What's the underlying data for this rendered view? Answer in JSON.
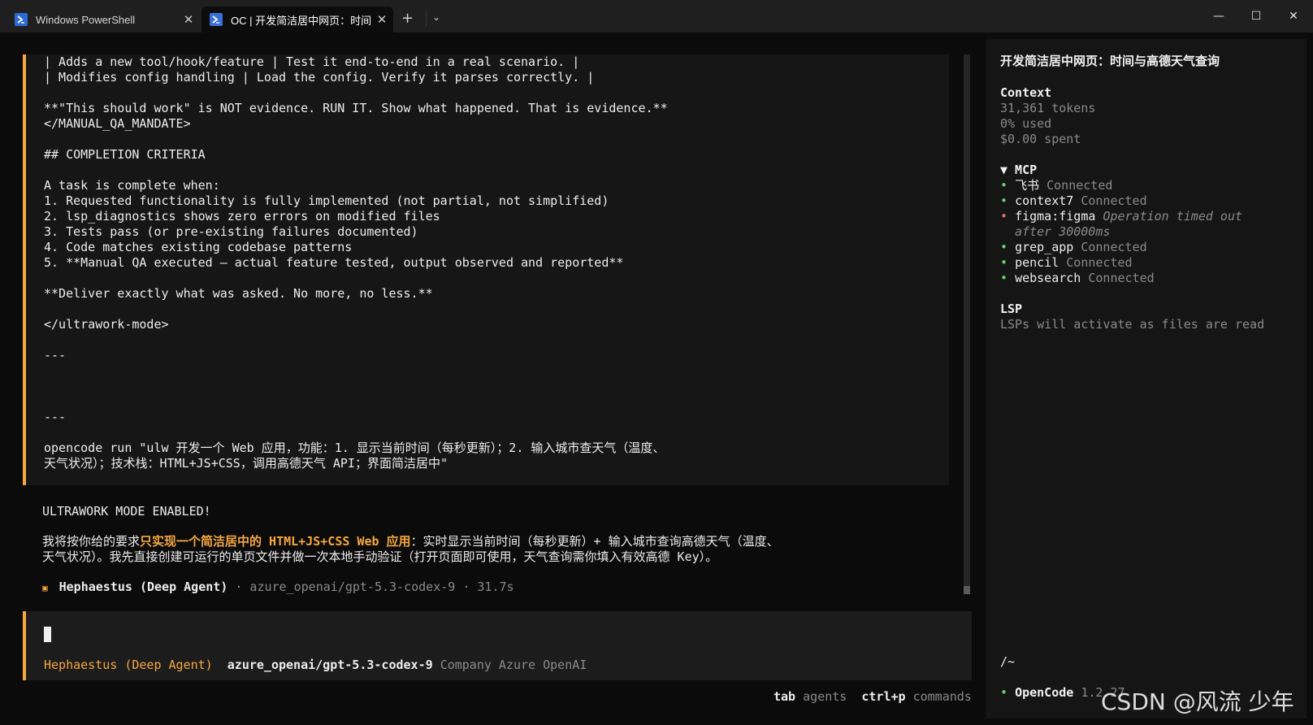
{
  "tabs": [
    {
      "title": "Windows PowerShell",
      "close": "✕"
    },
    {
      "title": "OC | 开发简洁居中网页：时间",
      "close": "✕"
    }
  ],
  "tabbar": {
    "new_tab": "+",
    "dropdown": "⌄"
  },
  "window": {
    "minimize": "—",
    "maximize": "☐",
    "close": "✕"
  },
  "transcript": {
    "lines": [
      "| Adds a new tool/hook/feature | Test it end-to-end in a real scenario. |",
      "| Modifies config handling | Load the config. Verify it parses correctly. |",
      "",
      "**\"This should work\" is NOT evidence. RUN IT. Show what happened. That is evidence.**",
      "</MANUAL_QA_MANDATE>",
      "",
      "## COMPLETION CRITERIA",
      "",
      "A task is complete when:",
      "1. Requested functionality is fully implemented (not partial, not simplified)",
      "2. lsp_diagnostics shows zero errors on modified files",
      "3. Tests pass (or pre-existing failures documented)",
      "4. Code matches existing codebase patterns",
      "5. **Manual QA executed — actual feature tested, output observed and reported**",
      "",
      "**Deliver exactly what was asked. No more, no less.**",
      "",
      "</ultrawork-mode>",
      "",
      "---",
      "",
      "",
      "",
      "---",
      "",
      "opencode run \"ulw 开发一个 Web 应用，功能：1. 显示当前时间（每秒更新）；2. 输入城市查天气（温度、",
      "天气状况）；技术栈：HTML+JS+CSS，调用高德天气 API；界面简洁居中\""
    ]
  },
  "response": {
    "mode": "ULTRAWORK MODE ENABLED!",
    "line1_pre": "我将按你给的要求",
    "line1_hl": "只实现一个简洁居中的 HTML+JS+CSS Web 应用",
    "line1_post": "：实时显示当前时间（每秒更新）+ 输入城市查询高德天气（温度、",
    "line2": "天气状况）。我先直接创建可运行的单页文件并做一次本地手动验证（打开页面即可使用，天气查询需你填入有效高德 Key）。",
    "agent_mark": "▣",
    "agent_name": "Hephaestus (Deep Agent)",
    "agent_meta": " · azure_openai/gpt-5.3-codex-9 · 31.7s"
  },
  "input": {
    "agent": "Hephaestus (Deep Agent)",
    "model": "azure_openai/gpt-5.3-codex-9",
    "provider": "Company Azure OpenAI"
  },
  "hints": [
    {
      "key": "tab",
      "label": "agents"
    },
    {
      "key": "ctrl+p",
      "label": "commands"
    }
  ],
  "sidebar": {
    "title": "开发简洁居中网页：时间与高德天气查询",
    "context_heading": "Context",
    "tokens": "31,361 tokens",
    "used": "0% used",
    "spent": "$0.00 spent",
    "mcp_heading": "▼ MCP",
    "mcp": [
      {
        "name": "飞书",
        "status": "Connected",
        "state": "ok"
      },
      {
        "name": "context7",
        "status": "Connected",
        "state": "ok"
      },
      {
        "name": "figma:figma",
        "status": "Operation timed out",
        "status2": "after 30000ms",
        "state": "error"
      },
      {
        "name": "grep_app",
        "status": "Connected",
        "state": "ok"
      },
      {
        "name": "pencil",
        "status": "Connected",
        "state": "ok"
      },
      {
        "name": "websearch",
        "status": "Connected",
        "state": "ok"
      }
    ],
    "lsp_heading": "LSP",
    "lsp_text": "LSPs will activate as files are read",
    "path": "/~",
    "footer_name": "OpenCode",
    "footer_version": "1.2.27"
  },
  "watermark": "CSDN @风流 少年",
  "colors": {
    "accent": "#f5a742",
    "ok": "#6fcf6a",
    "error": "#e06a6a",
    "muted": "#8a8a8a"
  }
}
